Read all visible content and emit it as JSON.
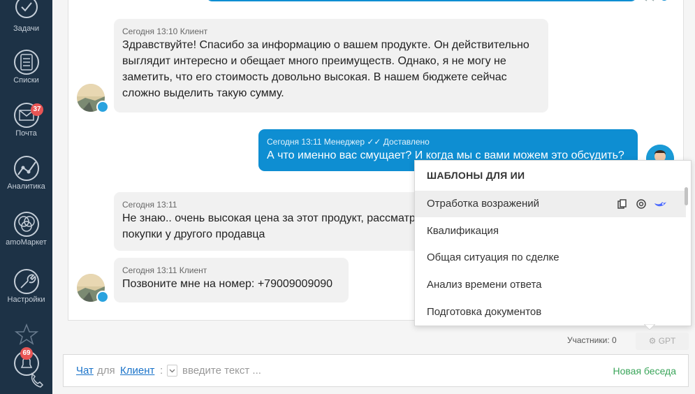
{
  "sidebar": {
    "tasks": "Задачи",
    "lists": "Списки",
    "mail": "Почта",
    "mail_badge": "37",
    "analytics": "Аналитика",
    "market": "amoМаркет",
    "settings": "Настройки",
    "notifications_badge": "69"
  },
  "messages": [
    {
      "meta": "Сегодня 13:10 Клиент",
      "text": "Здравствуйте! Спасибо за информацию о вашем продукте. Он действительно выглядит интересно и обещает много преимуществ. Однако, я не могу не заметить, что его стоимость довольно высокая. В нашем бюджете сейчас сложно выделить такую сумму."
    },
    {
      "meta": "Сегодня 13:11 Менеджер ✓✓ Доставлено",
      "text": "А что именно вас смущает? И когда мы с вами можем это обсудить?"
    },
    {
      "meta": "Сегодня 13:11",
      "text": "Не знаю.. очень высокая цена за этот продукт, рассматриваю вариант покупки у другого продавца"
    },
    {
      "meta": "Сегодня 13:11 Клиент",
      "text": "Позвоните мне на номер: +79009009090"
    }
  ],
  "templates": {
    "title": "ШАБЛОНЫ ДЛЯ ИИ",
    "items": [
      "Отработка возражений",
      "Квалификация",
      "Общая ситуация по сделке",
      "Анализ времени ответа",
      "Подготовка документов"
    ]
  },
  "footer": {
    "participants": "Участники: 0",
    "gpt": "GPT"
  },
  "composer": {
    "chat_link": "Чат",
    "for": "для",
    "client_link": "Клиент",
    "colon": ":",
    "placeholder": "введите текст ...",
    "new_conversation": "Новая беседа"
  },
  "colors": {
    "sidebar": "#1d3246",
    "accent": "#0e8ed2",
    "badge": "#e85555",
    "link": "#1a73c9",
    "new_conversation": "#3aa55a"
  }
}
